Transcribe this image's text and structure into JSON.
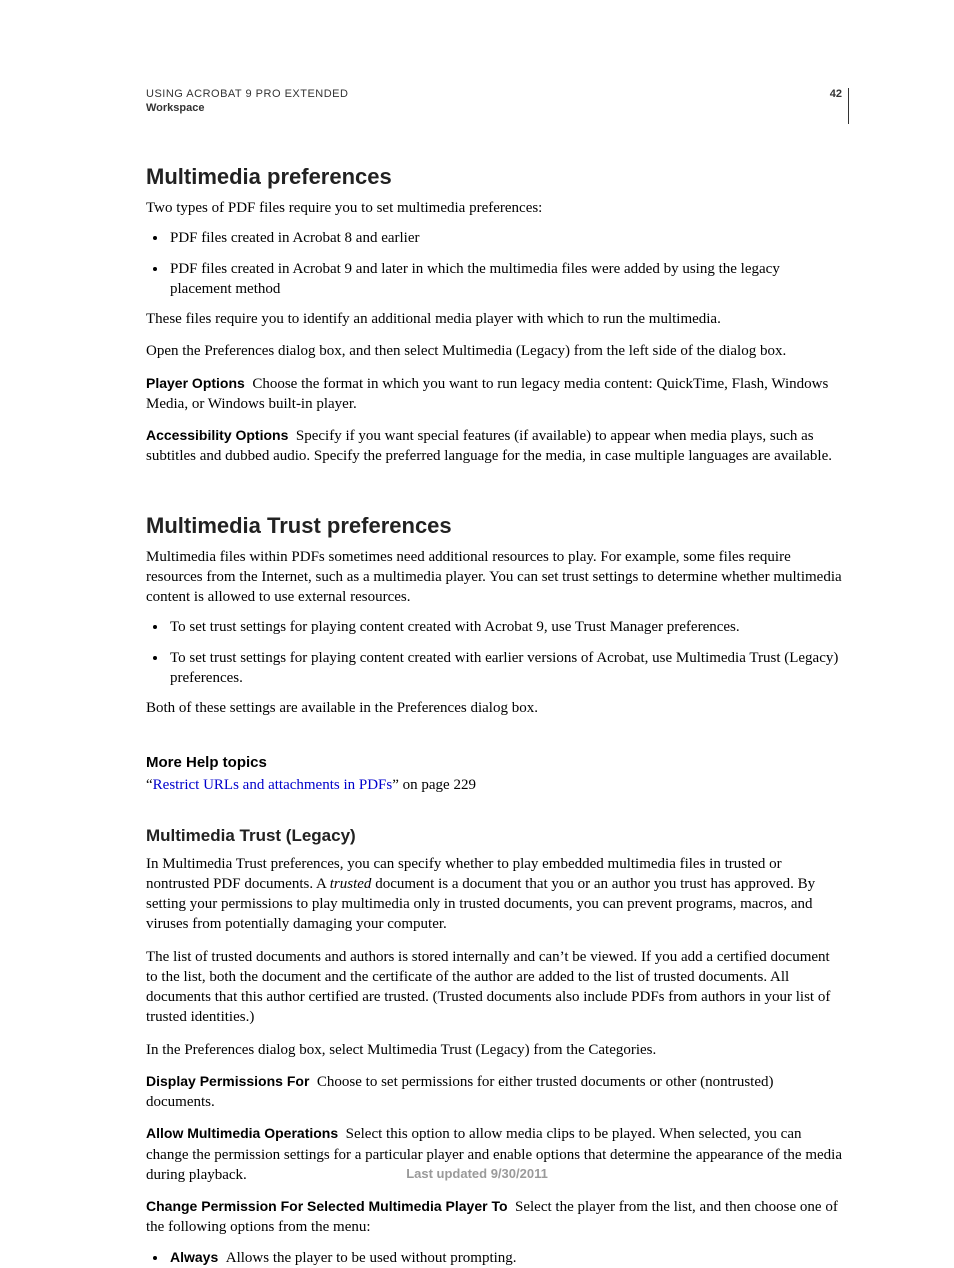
{
  "header": {
    "product": "USING ACROBAT 9 PRO EXTENDED",
    "section": "Workspace",
    "page_number": "42"
  },
  "s1": {
    "title": "Multimedia preferences",
    "p1": "Two types of PDF files require you to set multimedia preferences:",
    "b1": "PDF files created in Acrobat 8 and earlier",
    "b2": "PDF files created in Acrobat 9 and later in which the multimedia files were added by using the legacy placement method",
    "p2": "These files require you to identify an additional media player with which to run the multimedia.",
    "p3": "Open the Preferences dialog box, and then select Multimedia (Legacy) from the left side of the dialog box.",
    "opt1_label": "Player Options",
    "opt1_text": "Choose the format in which you want to run legacy media content: QuickTime, Flash, Windows Media, or Windows built-in player.",
    "opt2_label": "Accessibility Options",
    "opt2_text": "Specify if you want special features (if available) to appear when media plays, such as subtitles and dubbed audio. Specify the preferred language for the media, in case multiple languages are available."
  },
  "s2": {
    "title": "Multimedia Trust preferences",
    "p1": "Multimedia files within PDFs sometimes need additional resources to play. For example, some files require resources from the Internet, such as a multimedia player. You can set trust settings to determine whether multimedia content is allowed to use external resources.",
    "b1": "To set trust settings for playing content created with Acrobat 9, use Trust Manager preferences.",
    "b2": "To set trust settings for playing content created with earlier versions of Acrobat, use Multimedia Trust (Legacy) preferences.",
    "p2": "Both of these settings are available in the Preferences dialog box.",
    "more_help_title": "More Help topics",
    "link_open_quote": "“",
    "link_text": "Restrict URLs and attachments in PDFs",
    "link_tail": "” on page 229"
  },
  "s3": {
    "title": "Multimedia Trust (Legacy)",
    "p1a": "In Multimedia Trust preferences, you can specify whether to play embedded multimedia files in trusted or nontrusted PDF documents. A ",
    "p1_em": "trusted",
    "p1b": " document is a document that you or an author you trust has approved. By setting your permissions to play multimedia only in trusted documents, you can prevent programs, macros, and viruses from potentially damaging your computer.",
    "p2": "The list of trusted documents and authors is stored internally and can’t be viewed. If you add a certified document to the list, both the document and the certificate of the author are added to the list of trusted documents. All documents that this author certified are trusted. (Trusted documents also include PDFs from authors in your list of trusted identities.)",
    "p3": "In the Preferences dialog box, select Multimedia Trust (Legacy) from the Categories.",
    "opt1_label": "Display Permissions For",
    "opt1_text": "Choose to set permissions for either trusted documents or other (nontrusted) documents.",
    "opt2_label": "Allow Multimedia Operations",
    "opt2_text": "Select this option to allow media clips to be played. When selected, you can change the permission settings for a particular player and enable options that determine the appearance of the media during playback.",
    "opt3_label": "Change Permission For Selected Multimedia Player To",
    "opt3_text": "Select the player from the list, and then choose one of the following options from the menu:",
    "sub_b1_label": "Always",
    "sub_b1_text": "Allows the player to be used without prompting."
  },
  "footer": {
    "text": "Last updated 9/30/2011"
  }
}
